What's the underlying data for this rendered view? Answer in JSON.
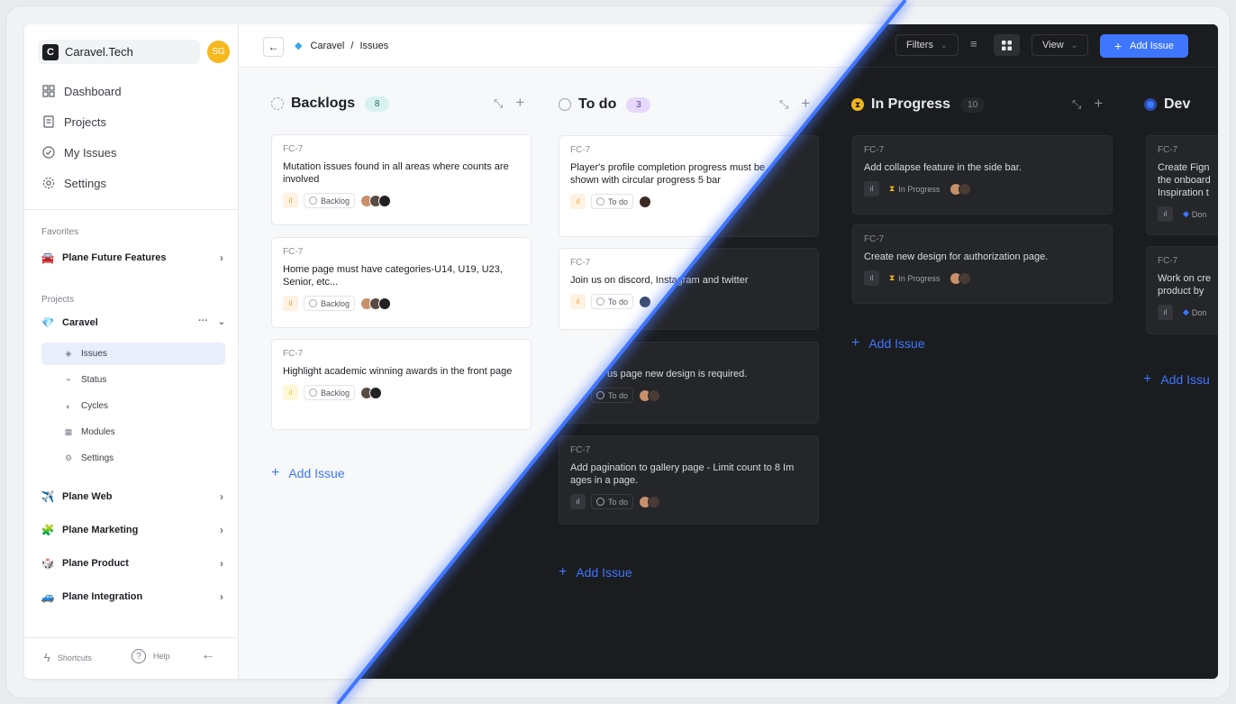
{
  "workspace": {
    "logo": "C",
    "name": "Caravel.Tech",
    "user_initials": "SG"
  },
  "nav": [
    {
      "label": "Dashboard",
      "icon": "grid-icon"
    },
    {
      "label": "Projects",
      "icon": "file-icon"
    },
    {
      "label": "My Issues",
      "icon": "check-circle-icon"
    },
    {
      "label": "Settings",
      "icon": "gear-icon"
    }
  ],
  "favorites": {
    "label": "Favorites",
    "items": [
      {
        "emoji": "🚘",
        "label": "Plane Future Features"
      }
    ]
  },
  "projects": {
    "label": "Projects",
    "current": {
      "emoji": "💎",
      "label": "Caravel",
      "more": "···"
    },
    "sub_items": [
      {
        "label": "Issues",
        "icon": "layers-icon"
      },
      {
        "label": "Status",
        "icon": "pulse-icon"
      },
      {
        "label": "Cycles",
        "icon": "contrast-icon"
      },
      {
        "label": "Modules",
        "icon": "table-icon"
      },
      {
        "label": "Settings",
        "icon": "gear-icon"
      }
    ],
    "others": [
      {
        "emoji": "✈️",
        "label": "Plane Web"
      },
      {
        "emoji": "🧩",
        "label": "Plane Marketing"
      },
      {
        "emoji": "🎲",
        "label": "Plane Product"
      },
      {
        "emoji": "🚙",
        "label": "Plane Integration"
      }
    ]
  },
  "footer": {
    "shortcuts": "Shortcuts",
    "help": "Help"
  },
  "header": {
    "breadcrumb_project": "Caravel",
    "breadcrumb_sep": "/",
    "breadcrumb_page": "Issues",
    "filters_label": "Filters",
    "view_label": "View",
    "add_issue_label": "Add Issue"
  },
  "columns": [
    {
      "title": "Backlogs",
      "count": "8",
      "cards": [
        {
          "key": "FC-7",
          "title": "Mutation issues found in all areas where counts are involved",
          "state": "Backlog"
        },
        {
          "key": "FC-7",
          "title": "Home page must have categories-U14, U19, U23, Senior, etc...",
          "state": "Backlog"
        },
        {
          "key": "FC-7",
          "title": "Highlight academic winning awards in the front page",
          "state": "Backlog"
        }
      ],
      "add_label": "Add Issue"
    },
    {
      "title": "To do",
      "count": "3",
      "cards": [
        {
          "key": "FC-7",
          "title": "Player's profile completion progress must be shown with circular progress 5 bar",
          "state": "To do"
        },
        {
          "key": "FC-7",
          "title": "Join us on discord, Instagram and twitter",
          "state": "To do"
        },
        {
          "key": "FC-7",
          "title": "Contact us page new design is required.",
          "state": "To do"
        },
        {
          "key": "FC-7",
          "title": "Add pagination to gallery page -  Limit count to 8 Im ages in a page.",
          "state": "To do"
        }
      ],
      "add_label": "Add Issue"
    },
    {
      "title": "In Progress",
      "count": "10",
      "cards": [
        {
          "key": "FC-7",
          "title": "Add collapse feature in the side bar.",
          "state": "In Progress"
        },
        {
          "key": "FC-7",
          "title": "Create new design for authorization page.",
          "state": "In Progress"
        }
      ],
      "add_label": "Add Issue"
    },
    {
      "title": "Dev",
      "cards": [
        {
          "key": "FC-7",
          "title": "Create Fign the onboard Inspiration t",
          "state": "Don"
        },
        {
          "key": "FC-7",
          "title": "Work on cre product by",
          "state": "Don"
        }
      ],
      "add_label": "Add Issu"
    }
  ],
  "colors": {
    "accent": "#3f76ff",
    "dark_bg": "#1b1c1f",
    "dark_card": "#25262a",
    "count_backlog": "#d7f2ef",
    "count_todo": "#e5d8fb"
  }
}
